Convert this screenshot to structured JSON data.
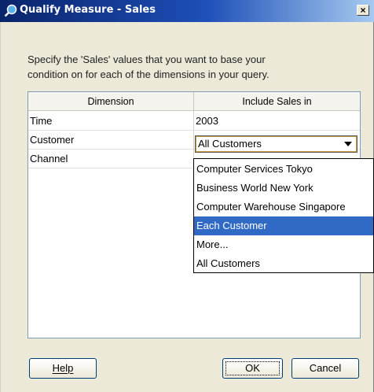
{
  "window": {
    "title": "Qualify Measure - Sales",
    "close_symbol": "×",
    "icon": "search-icon"
  },
  "instructions": {
    "line1": "Specify the 'Sales' values that you want to base your",
    "line2": "condition on for each of the dimensions in your query."
  },
  "table": {
    "columns": [
      "Dimension",
      "Include Sales in"
    ],
    "rows": [
      {
        "dimension": "Time",
        "value": "2003"
      },
      {
        "dimension": "Customer",
        "value": "All Customers"
      },
      {
        "dimension": "Channel",
        "value": ""
      }
    ]
  },
  "dropdown": {
    "options": [
      "Computer Services Tokyo",
      "Business World New York",
      "Computer Warehouse Singapore",
      "Each Customer",
      "More...",
      "All Customers"
    ],
    "highlighted": "Each Customer"
  },
  "buttons": {
    "help": "Help",
    "ok": "OK",
    "cancel": "Cancel"
  }
}
